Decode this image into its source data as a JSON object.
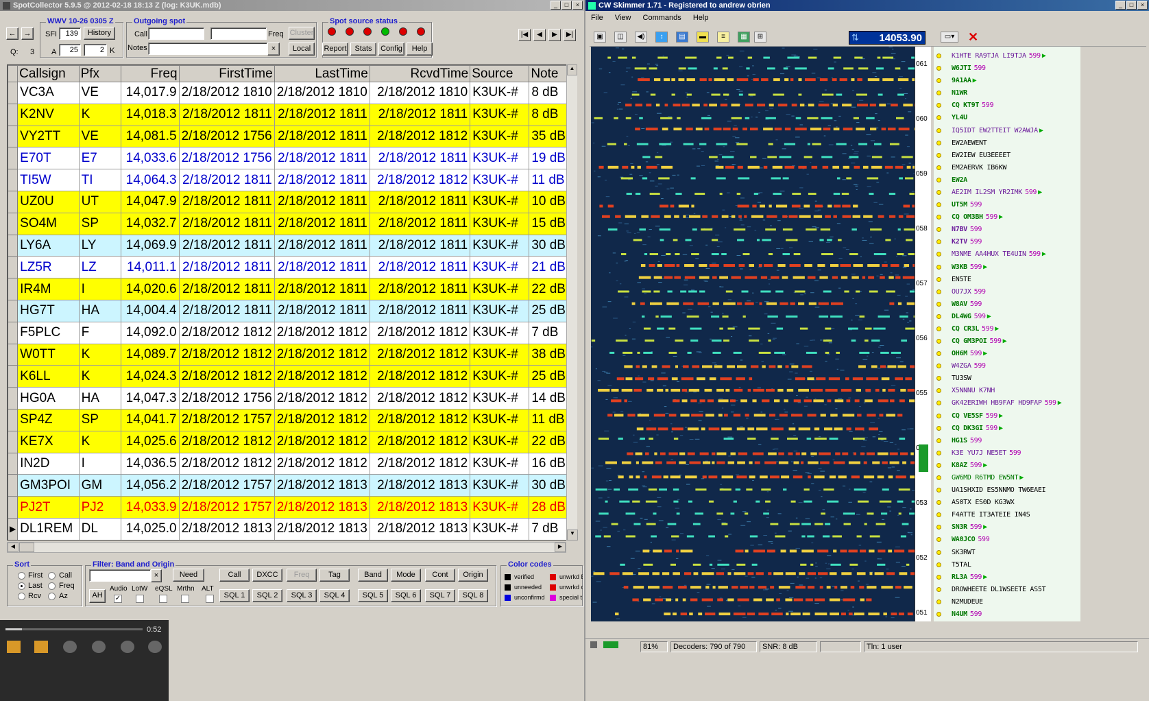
{
  "sc": {
    "title": "SpotCollector 5.9.5 @ 2012-02-18  18:13 Z (log: K3UK.mdb)",
    "wwv_title": "WWV 10-26 0305 Z",
    "sfi_label": "SFI",
    "sfi": "139",
    "history": "History",
    "q_label": "Q:",
    "q_val": "3",
    "a_label": "A",
    "a_val": "25",
    "k_val": "2",
    "k_label": "K",
    "outgoing_title": "Outgoing spot",
    "call_label": "Call",
    "freq_label": "Freq",
    "cluster": "Cluster",
    "notes_label": "Notes",
    "local": "Local",
    "spot_source_title": "Spot source status",
    "led_colors": [
      "#dd0000",
      "#dd0000",
      "#dd0000",
      "#00bb00",
      "#dd0000",
      "#dd0000"
    ],
    "report": "Report",
    "stats": "Stats",
    "config": "Config",
    "help": "Help",
    "columns": [
      "Callsign",
      "Pfx",
      "Freq",
      "FirstTime",
      "LastTime",
      "RcvdTime",
      "Source",
      "Note"
    ],
    "rows": [
      {
        "call": "VC3A",
        "pfx": "VE",
        "freq": "14,017.9",
        "first": "2/18/2012 1810",
        "last": "2/18/2012 1810",
        "rcvd": "2/18/2012 1810",
        "src": "K3UK-#",
        "note": "8 dB",
        "bg": "#ffffff",
        "fg": "#000000"
      },
      {
        "call": "K2NV",
        "pfx": "K",
        "freq": "14,018.3",
        "first": "2/18/2012 1811",
        "last": "2/18/2012 1811",
        "rcvd": "2/18/2012 1811",
        "src": "K3UK-#",
        "note": "8 dB",
        "bg": "#ffff00",
        "fg": "#000000"
      },
      {
        "call": "VY2TT",
        "pfx": "VE",
        "freq": "14,081.5",
        "first": "2/18/2012 1756",
        "last": "2/18/2012 1811",
        "rcvd": "2/18/2012 1812",
        "src": "K3UK-#",
        "note": "35 dB",
        "bg": "#ffff00",
        "fg": "#000000"
      },
      {
        "call": "E70T",
        "pfx": "E7",
        "freq": "14,033.6",
        "first": "2/18/2012 1756",
        "last": "2/18/2012 1811",
        "rcvd": "2/18/2012 1811",
        "src": "K3UK-#",
        "note": "19 dB",
        "bg": "#ffffff",
        "fg": "#0000cc"
      },
      {
        "call": "TI5W",
        "pfx": "TI",
        "freq": "14,064.3",
        "first": "2/18/2012 1811",
        "last": "2/18/2012 1811",
        "rcvd": "2/18/2012 1812",
        "src": "K3UK-#",
        "note": "11 dB",
        "bg": "#ffffff",
        "fg": "#0000cc"
      },
      {
        "call": "UZ0U",
        "pfx": "UT",
        "freq": "14,047.9",
        "first": "2/18/2012 1811",
        "last": "2/18/2012 1811",
        "rcvd": "2/18/2012 1811",
        "src": "K3UK-#",
        "note": "10 dB",
        "bg": "#ffff00",
        "fg": "#000000"
      },
      {
        "call": "SO4M",
        "pfx": "SP",
        "freq": "14,032.7",
        "first": "2/18/2012 1811",
        "last": "2/18/2012 1811",
        "rcvd": "2/18/2012 1811",
        "src": "K3UK-#",
        "note": "15 dB",
        "bg": "#ffff00",
        "fg": "#000000"
      },
      {
        "call": "LY6A",
        "pfx": "LY",
        "freq": "14,069.9",
        "first": "2/18/2012 1811",
        "last": "2/18/2012 1811",
        "rcvd": "2/18/2012 1811",
        "src": "K3UK-#",
        "note": "30 dB",
        "bg": "#ccf5ff",
        "fg": "#000000"
      },
      {
        "call": "LZ5R",
        "pfx": "LZ",
        "freq": "14,011.1",
        "first": "2/18/2012 1811",
        "last": "2/18/2012 1811",
        "rcvd": "2/18/2012 1811",
        "src": "K3UK-#",
        "note": "21 dB",
        "bg": "#ffffff",
        "fg": "#0000cc"
      },
      {
        "call": "IR4M",
        "pfx": "I",
        "freq": "14,020.6",
        "first": "2/18/2012 1811",
        "last": "2/18/2012 1811",
        "rcvd": "2/18/2012 1811",
        "src": "K3UK-#",
        "note": "22 dB",
        "bg": "#ffff00",
        "fg": "#000000"
      },
      {
        "call": "HG7T",
        "pfx": "HA",
        "freq": "14,004.4",
        "first": "2/18/2012 1811",
        "last": "2/18/2012 1811",
        "rcvd": "2/18/2012 1811",
        "src": "K3UK-#",
        "note": "25 dB",
        "bg": "#ccf5ff",
        "fg": "#000000"
      },
      {
        "call": "F5PLC",
        "pfx": "F",
        "freq": "14,092.0",
        "first": "2/18/2012 1812",
        "last": "2/18/2012 1812",
        "rcvd": "2/18/2012 1812",
        "src": "K3UK-#",
        "note": "7 dB",
        "bg": "#ffffff",
        "fg": "#000000"
      },
      {
        "call": "W0TT",
        "pfx": "K",
        "freq": "14,089.7",
        "first": "2/18/2012 1812",
        "last": "2/18/2012 1812",
        "rcvd": "2/18/2012 1812",
        "src": "K3UK-#",
        "note": "38 dB",
        "bg": "#ffff00",
        "fg": "#000000"
      },
      {
        "call": "K6LL",
        "pfx": "K",
        "freq": "14,024.3",
        "first": "2/18/2012 1812",
        "last": "2/18/2012 1812",
        "rcvd": "2/18/2012 1812",
        "src": "K3UK-#",
        "note": "25 dB",
        "bg": "#ffff00",
        "fg": "#000000"
      },
      {
        "call": "HG0A",
        "pfx": "HA",
        "freq": "14,047.3",
        "first": "2/18/2012 1756",
        "last": "2/18/2012 1812",
        "rcvd": "2/18/2012 1812",
        "src": "K3UK-#",
        "note": "14 dB",
        "bg": "#ffffff",
        "fg": "#000000"
      },
      {
        "call": "SP4Z",
        "pfx": "SP",
        "freq": "14,041.7",
        "first": "2/18/2012 1757",
        "last": "2/18/2012 1812",
        "rcvd": "2/18/2012 1812",
        "src": "K3UK-#",
        "note": "11 dB",
        "bg": "#ffff00",
        "fg": "#000000"
      },
      {
        "call": "KE7X",
        "pfx": "K",
        "freq": "14,025.6",
        "first": "2/18/2012 1812",
        "last": "2/18/2012 1812",
        "rcvd": "2/18/2012 1812",
        "src": "K3UK-#",
        "note": "22 dB",
        "bg": "#ffff00",
        "fg": "#000000"
      },
      {
        "call": "IN2D",
        "pfx": "I",
        "freq": "14,036.5",
        "first": "2/18/2012 1812",
        "last": "2/18/2012 1812",
        "rcvd": "2/18/2012 1812",
        "src": "K3UK-#",
        "note": "16 dB",
        "bg": "#ffffff",
        "fg": "#000000"
      },
      {
        "call": "GM3POI",
        "pfx": "GM",
        "freq": "14,056.2",
        "first": "2/18/2012 1757",
        "last": "2/18/2012 1813",
        "rcvd": "2/18/2012 1813",
        "src": "K3UK-#",
        "note": "30 dB",
        "bg": "#ccf5ff",
        "fg": "#000000"
      },
      {
        "call": "PJ2T",
        "pfx": "PJ2",
        "freq": "14,033.9",
        "first": "2/18/2012 1757",
        "last": "2/18/2012 1813",
        "rcvd": "2/18/2012 1813",
        "src": "K3UK-#",
        "note": "28 dB",
        "bg": "#ffff00",
        "fg": "#ee0000"
      },
      {
        "call": "DL1REM",
        "pfx": "DL",
        "freq": "14,025.0",
        "first": "2/18/2012 1813",
        "last": "2/18/2012 1813",
        "rcvd": "2/18/2012 1813",
        "src": "K3UK-#",
        "note": "7 dB",
        "bg": "#ffffff",
        "fg": "#000000",
        "current": true
      }
    ],
    "sort_title": "Sort",
    "sort_opts": [
      "First",
      "Call",
      "Last",
      "Freq",
      "Rcv",
      "Az"
    ],
    "filter_title": "Filter: Band and Origin",
    "need": "Need",
    "filter_btns": [
      "Call",
      "DXCC",
      "Freq",
      "Tag",
      "Band",
      "Mode",
      "Cont",
      "Origin"
    ],
    "sql_btns": [
      "SQL 1",
      "SQL 2",
      "SQL 3",
      "SQL 4",
      "SQL 5",
      "SQL 6",
      "SQL 7",
      "SQL 8"
    ],
    "ah": "AH",
    "chk_labels": [
      "Audio",
      "LotW",
      "eQSL",
      "Mrthn",
      "ALT"
    ],
    "color_title": "Color codes",
    "codes": [
      {
        "label": "verified",
        "color": "#000000"
      },
      {
        "label": "unneeded",
        "color": "#000000"
      },
      {
        "label": "unconfirmd",
        "color": "#0000dd"
      },
      {
        "label": "unwrkd B",
        "color": "#dd0000"
      },
      {
        "label": "unwrkd c",
        "color": "#dd0000"
      },
      {
        "label": "special t",
        "color": "#dd00dd"
      }
    ],
    "player_time": "0:52"
  },
  "cw": {
    "title": "CW Skimmer 1.71 - Registered to andrew obrien",
    "menu": [
      "File",
      "View",
      "Commands",
      "Help"
    ],
    "freq": "14053.90",
    "ticks": [
      "061",
      "060",
      "059",
      "058",
      "057",
      "056",
      "055",
      "054",
      "053",
      "052",
      "051"
    ],
    "callouts": [
      {
        "text": "K1HTE RA9TJA LI9TJA",
        "snr": "599",
        "color": "#6a1a9a",
        "bold": false,
        "arrow": true
      },
      {
        "text": "W6JTI",
        "snr": "599",
        "color": "#007700",
        "bold": true,
        "arrow": false
      },
      {
        "text": "9A1AA",
        "snr": "",
        "color": "#007700",
        "bold": true,
        "arrow": true
      },
      {
        "text": "N1WR",
        "snr": "",
        "color": "#007700",
        "bold": true,
        "arrow": false
      },
      {
        "text": "CQ KT9T",
        "snr": "599",
        "color": "#007700",
        "bold": true,
        "arrow": false
      },
      {
        "text": "YL4U",
        "snr": "",
        "color": "#007700",
        "bold": true,
        "arrow": false
      },
      {
        "text": "IQ5IDT EW2TTEIT W2AWJA",
        "snr": "",
        "color": "#6a1a9a",
        "bold": false,
        "arrow": true
      },
      {
        "text": "EW2AEWENT",
        "snr": "",
        "color": "#000000",
        "bold": false,
        "arrow": false
      },
      {
        "text": "EW2IEW EU3EEEET",
        "snr": "",
        "color": "#000000",
        "bold": false,
        "arrow": false
      },
      {
        "text": "EM2AERVK IB6KW",
        "snr": "",
        "color": "#000000",
        "bold": false,
        "arrow": false
      },
      {
        "text": "EW2A",
        "snr": "",
        "color": "#007700",
        "bold": true,
        "arrow": false
      },
      {
        "text": "AE2IM IL2SM YR2IMK",
        "snr": "599",
        "color": "#6a1a9a",
        "bold": false,
        "arrow": true
      },
      {
        "text": "UT5M",
        "snr": "599",
        "color": "#007700",
        "bold": true,
        "arrow": false
      },
      {
        "text": "CQ OM3BH",
        "snr": "599",
        "color": "#007700",
        "bold": true,
        "arrow": true
      },
      {
        "text": "N7BV",
        "snr": "599",
        "color": "#6a1a9a",
        "bold": true,
        "arrow": false
      },
      {
        "text": "K2TV",
        "snr": "599",
        "color": "#6a1a9a",
        "bold": true,
        "arrow": false
      },
      {
        "text": "M3NME AA4HUX TE4UIN",
        "snr": "599",
        "color": "#6a1a9a",
        "bold": false,
        "arrow": true
      },
      {
        "text": "W3KB",
        "snr": "599",
        "color": "#007700",
        "bold": true,
        "arrow": true
      },
      {
        "text": "EN5TE",
        "snr": "",
        "color": "#000000",
        "bold": false,
        "arrow": false
      },
      {
        "text": "OU7JX",
        "snr": "599",
        "color": "#6a1a9a",
        "bold": false,
        "arrow": false
      },
      {
        "text": "W8AV",
        "snr": "599",
        "color": "#007700",
        "bold": true,
        "arrow": false
      },
      {
        "text": "DL4WG",
        "snr": "599",
        "color": "#007700",
        "bold": true,
        "arrow": true
      },
      {
        "text": "CQ CR3L",
        "snr": "599",
        "color": "#007700",
        "bold": true,
        "arrow": true
      },
      {
        "text": "CQ GM3POI",
        "snr": "599",
        "color": "#007700",
        "bold": true,
        "arrow": true
      },
      {
        "text": "OH6M",
        "snr": "599",
        "color": "#007700",
        "bold": true,
        "arrow": true
      },
      {
        "text": "W4ZGA",
        "snr": "599",
        "color": "#6a1a9a",
        "bold": false,
        "arrow": false
      },
      {
        "text": "TU3SW",
        "snr": "",
        "color": "#000000",
        "bold": false,
        "arrow": false
      },
      {
        "text": "X5NNNU K7NH",
        "snr": "",
        "color": "#6a1a9a",
        "bold": false,
        "arrow": false
      },
      {
        "text": "GK42ERIWH HB9FAF HD9FAP",
        "snr": "599",
        "color": "#6a1a9a",
        "bold": false,
        "arrow": true
      },
      {
        "text": "CQ VE5SF",
        "snr": "599",
        "color": "#007700",
        "bold": true,
        "arrow": true
      },
      {
        "text": "CQ DK3GI",
        "snr": "599",
        "color": "#007700",
        "bold": true,
        "arrow": true
      },
      {
        "text": "HG1S",
        "snr": "599",
        "color": "#007700",
        "bold": true,
        "arrow": false
      },
      {
        "text": "K3E YU7J NE5ET",
        "snr": "599",
        "color": "#6a1a9a",
        "bold": false,
        "arrow": false
      },
      {
        "text": "K8AZ",
        "snr": "599",
        "color": "#007700",
        "bold": true,
        "arrow": true
      },
      {
        "text": "GW6MD R6TMD EW5NT",
        "snr": "",
        "color": "#007700",
        "bold": false,
        "arrow": true
      },
      {
        "text": "UA1SHXID ES5NNMO TW6EAEI",
        "snr": "",
        "color": "#000000",
        "bold": false,
        "arrow": false
      },
      {
        "text": "AS0TX ES0D KG3WX",
        "snr": "",
        "color": "#000000",
        "bold": false,
        "arrow": false
      },
      {
        "text": "F4ATTE IT3ATEIE IN4S",
        "snr": "",
        "color": "#000000",
        "bold": false,
        "arrow": false
      },
      {
        "text": "SN3R",
        "snr": "599",
        "color": "#007700",
        "bold": true,
        "arrow": true
      },
      {
        "text": "WA0JCO",
        "snr": "599",
        "color": "#007700",
        "bold": true,
        "arrow": false
      },
      {
        "text": "SK3RWT",
        "snr": "",
        "color": "#000000",
        "bold": false,
        "arrow": false
      },
      {
        "text": "T5TAL",
        "snr": "",
        "color": "#000000",
        "bold": false,
        "arrow": false
      },
      {
        "text": "RL3A",
        "snr": "599",
        "color": "#007700",
        "bold": true,
        "arrow": true
      },
      {
        "text": "DROWHEETE DL1WSEETE AS5T",
        "snr": "",
        "color": "#000000",
        "bold": false,
        "arrow": false
      },
      {
        "text": "N2MUDEUE",
        "snr": "",
        "color": "#000000",
        "bold": false,
        "arrow": false
      },
      {
        "text": "N4UM",
        "snr": "599",
        "color": "#007700",
        "bold": true,
        "arrow": false
      }
    ],
    "zoom": "81%",
    "decoders": "Decoders: 790 of 790",
    "snr": "SNR: 8 dB",
    "tln": "Tln: 1 user"
  }
}
